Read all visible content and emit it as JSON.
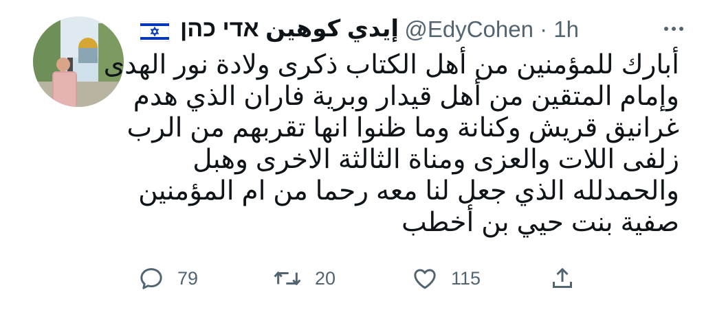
{
  "author": {
    "display_name": "إيدي كوهين אדי כהן",
    "handle": "@EdyCohen",
    "separator": "·",
    "timestamp": "1h",
    "flag_icon": "israel-flag-icon"
  },
  "tweet": {
    "lines": [
      "أبارك للمؤمنين من أهل الكتاب ذكرى ولادة نور الهدى",
      "وإمام المتقين من أهل قيدار وبرية فاران الذي هدم",
      "غرانيق قريش وكنانة وما ظنوا انها تقربهم من الرب",
      "زلفى اللات والعزى ومناة الثالثة الاخرى وهبل",
      "والحمدلله الذي جعل لنا معه رحما من ام المؤمنين",
      "صفية بنت حيي بن أخطب"
    ]
  },
  "actions": {
    "reply_count": "79",
    "retweet_count": "20",
    "like_count": "115",
    "icons": [
      "reply-icon",
      "retweet-icon",
      "like-icon",
      "share-icon"
    ]
  },
  "colors": {
    "text": "#0f1419",
    "muted": "#536471",
    "flag_blue": "#0038b8"
  }
}
